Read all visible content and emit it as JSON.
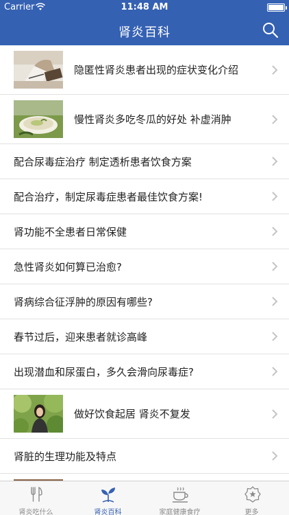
{
  "status": {
    "carrier": "Carrier",
    "time": "11:48 AM"
  },
  "nav": {
    "title": "肾炎百科"
  },
  "articles": [
    {
      "title": "隐匿性肾炎患者出现的症状变化介绍",
      "thumbnail": "thumb-person-writing"
    },
    {
      "title": "慢性肾炎多吃冬瓜的好处 补虚消肿",
      "thumbnail": "thumb-melon-soup"
    },
    {
      "title": "配合尿毒症治疗 制定透析患者饮食方案"
    },
    {
      "title": "配合治疗，制定尿毒症患者最佳饮食方案!"
    },
    {
      "title": "肾功能不全患者日常保健"
    },
    {
      "title": "急性肾炎如何算已治愈?"
    },
    {
      "title": "肾病综合征浮肿的原因有哪些?"
    },
    {
      "title": "春节过后，迎来患者就诊高峰"
    },
    {
      "title": "出现潜血和尿蛋白，多久会滑向尿毒症?"
    },
    {
      "title": "做好饮食起居 肾炎不复发",
      "thumbnail": "thumb-woman-outdoors"
    },
    {
      "title": "肾脏的生理功能及特点"
    }
  ],
  "tabs": [
    {
      "label": "肾炎吃什么",
      "icon": "fork-knife-icon",
      "active": false
    },
    {
      "label": "肾炎百科",
      "icon": "sprout-icon",
      "active": true
    },
    {
      "label": "家庭健康食疗",
      "icon": "teacup-icon",
      "active": false
    },
    {
      "label": "更多",
      "icon": "star-badge-icon",
      "active": false
    }
  ],
  "colors": {
    "brand": "#3561b3",
    "tab_inactive": "#8a8a8a",
    "separator": "#e1e1e1"
  }
}
